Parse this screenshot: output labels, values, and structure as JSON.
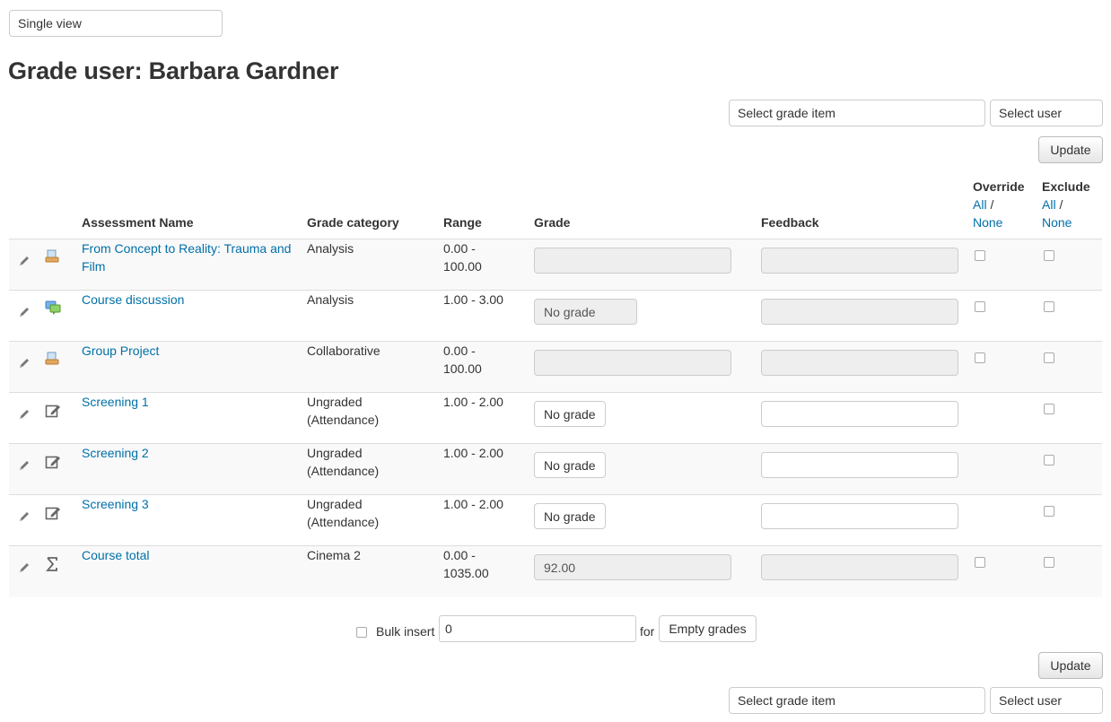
{
  "view_select": {
    "value": "Single view"
  },
  "page_title": "Grade user: Barbara Gardner",
  "top_controls": {
    "grade_item_select": "Select grade item",
    "user_select": "Select user",
    "update_label": "Update"
  },
  "table": {
    "headers": {
      "name": "Assessment Name",
      "category": "Grade category",
      "range": "Range",
      "grade": "Grade",
      "feedback": "Feedback",
      "override": "Override",
      "exclude": "Exclude",
      "all": "All",
      "separator": " /",
      "none": "None"
    },
    "rows": [
      {
        "icon": "assignment-icon",
        "name": "From Concept to Reality: Trauma and Film",
        "category": "Analysis",
        "range": "0.00 - 100.00",
        "grade": "",
        "grade_type": "disabled-text",
        "feedback": "",
        "feedback_disabled": true,
        "override": true,
        "exclude": true
      },
      {
        "icon": "forum-icon",
        "name": "Course discussion",
        "category": "Analysis",
        "range": "1.00 - 3.00",
        "grade": "No grade",
        "grade_type": "disabled-select",
        "feedback": "",
        "feedback_disabled": true,
        "override": true,
        "exclude": true
      },
      {
        "icon": "assignment-icon",
        "name": "Group Project",
        "category": "Collaborative",
        "range": "0.00 - 100.00",
        "grade": "",
        "grade_type": "disabled-text",
        "feedback": "",
        "feedback_disabled": true,
        "override": true,
        "exclude": true
      },
      {
        "icon": "manual-item-icon",
        "name": "Screening 1",
        "category": "Ungraded (Attendance)",
        "range": "1.00 - 2.00",
        "grade": "No grade",
        "grade_type": "select",
        "feedback": "",
        "feedback_disabled": false,
        "override": false,
        "exclude": true
      },
      {
        "icon": "manual-item-icon",
        "name": "Screening 2",
        "category": "Ungraded (Attendance)",
        "range": "1.00 - 2.00",
        "grade": "No grade",
        "grade_type": "select",
        "feedback": "",
        "feedback_disabled": false,
        "override": false,
        "exclude": true
      },
      {
        "icon": "manual-item-icon",
        "name": "Screening 3",
        "category": "Ungraded (Attendance)",
        "range": "1.00 - 2.00",
        "grade": "No grade",
        "grade_type": "select",
        "feedback": "",
        "feedback_disabled": false,
        "override": false,
        "exclude": true
      },
      {
        "icon": "sigma-icon",
        "name": "Course total",
        "category": "Cinema 2",
        "range": "0.00 - 1035.00",
        "grade": "92.00",
        "grade_type": "disabled-text",
        "feedback": "",
        "feedback_disabled": true,
        "override": true,
        "exclude": true
      }
    ]
  },
  "bulk": {
    "label": "Bulk insert",
    "value": "0",
    "for_label": "for",
    "target": "Empty grades"
  },
  "bottom_controls": {
    "update_label": "Update",
    "grade_item_select": "Select grade item",
    "user_select": "Select user"
  },
  "colors": {
    "link": "#0070a8",
    "row_stripe": "#f9f9f9",
    "disabled_field": "#eeeeee"
  }
}
